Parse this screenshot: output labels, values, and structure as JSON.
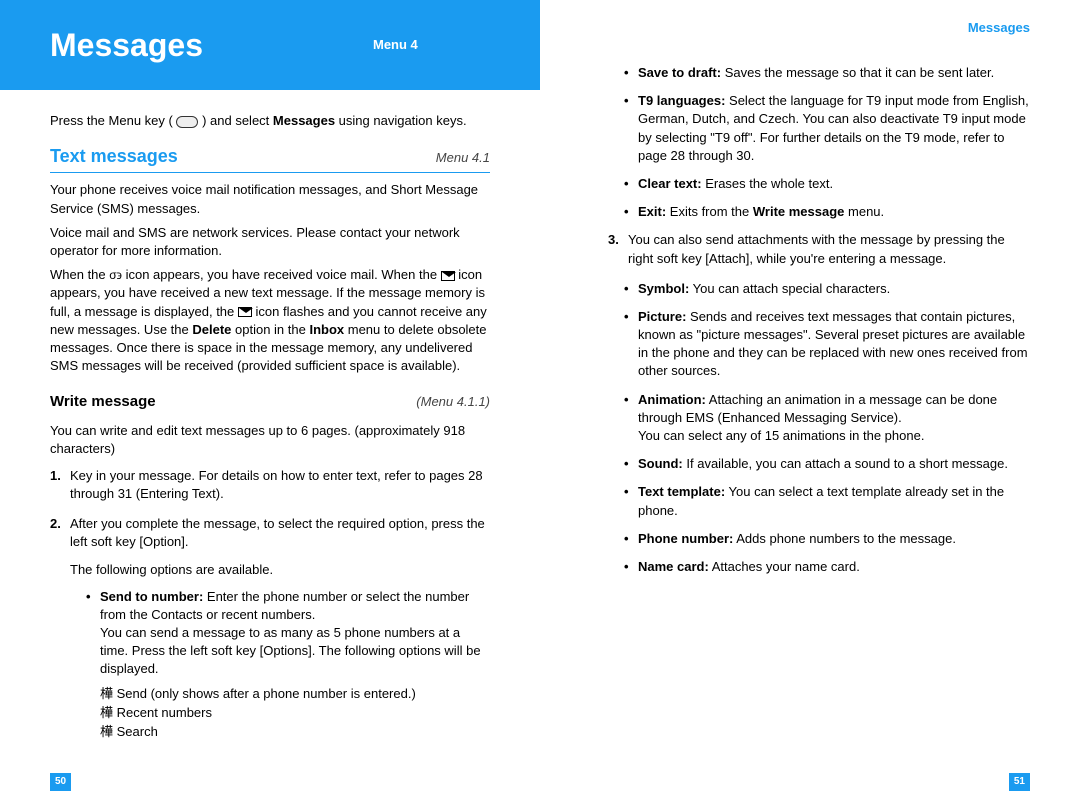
{
  "leftPage": {
    "header": {
      "title": "Messages",
      "menu": "Menu 4"
    },
    "intro_pre": "Press the Menu key (",
    "intro_post": ") and select ",
    "intro_bold": "Messages",
    "intro_end": " using navigation keys.",
    "section1": {
      "title": "Text messages",
      "menu": "Menu 4.1",
      "p1": "Your phone receives voice mail notification messages, and Short Message Service (SMS) messages.",
      "p2": "Voice mail and SMS are network services. Please contact your network operator for more information.",
      "p3a": "When the ",
      "p3b": " icon appears, you have received voice mail. When the ",
      "p3c": " icon appears, you have received a new text message. If the message memory is full, a message is displayed, the ",
      "p3d": " icon flashes and you cannot receive any new messages. Use the ",
      "p3e": "Delete",
      "p3f": " option in the ",
      "p3g": "Inbox",
      "p3h": " menu to delete obsolete messages. Once there is space in the message memory, any undelivered SMS messages will be received (provided sufficient space is available)."
    },
    "section2": {
      "title": "Write message",
      "menu": "(Menu 4.1.1)",
      "p1": "You can write and edit text messages up to 6 pages. (approximately 918 characters)",
      "step1": "Key in your message. For details on how to enter text, refer to pages 28 through 31 (Entering Text).",
      "step2": "After you complete the message, to select the required option, press the left soft key [Option].",
      "followup": "The following options are available.",
      "opt1_bold": "Send to number:",
      "opt1_text": " Enter the phone number or select the number from the Contacts or recent numbers.",
      "opt1_more": "You can send a message to as many as 5 phone numbers at a time. Press the left soft key [Options]. The following options will be displayed.",
      "sub1": "樺 Send (only shows after a phone number is entered.)",
      "sub2": "樺 Recent numbers",
      "sub3": "樺 Search"
    },
    "pageNumber": "50"
  },
  "rightPage": {
    "sectionLabel": "Messages",
    "opt_save_bold": "Save to draft:",
    "opt_save": " Saves the message so that it can be sent later.",
    "opt_t9_bold": "T9 languages:",
    "opt_t9": " Select the language for T9 input mode from English, German, Dutch, and Czech. You can also deactivate T9 input mode by selecting \"T9 off\". For further details on the T9 mode, refer to page 28 through 30.",
    "opt_clear_bold": "Clear text:",
    "opt_clear": " Erases the whole text.",
    "opt_exit_bold": "Exit:",
    "opt_exit_a": " Exits from the ",
    "opt_exit_b": "Write message",
    "opt_exit_c": " menu.",
    "step3": "You can also send attachments with the message by pressing the right soft key [Attach], while you're entering a message.",
    "att_symbol_bold": "Symbol:",
    "att_symbol": " You can attach special characters.",
    "att_picture_bold": "Picture:",
    "att_picture": " Sends and receives text messages that contain pictures, known as \"picture messages\". Several preset pictures are available in the phone and they can be replaced with new ones received from other sources.",
    "att_anim_bold": "Animation:",
    "att_anim": " Attaching an animation in a message can be done through EMS (Enhanced Messaging Service).",
    "att_anim2": "You can select any of 15 animations in the phone.",
    "att_sound_bold": "Sound:",
    "att_sound": " If available, you can attach a sound to a short message.",
    "att_tmpl_bold": "Text template:",
    "att_tmpl": " You can select a text template already set in the phone.",
    "att_phone_bold": "Phone number:",
    "att_phone": " Adds phone numbers to the message.",
    "att_card_bold": "Name card:",
    "att_card": " Attaches your name card.",
    "pageNumber": "51"
  }
}
